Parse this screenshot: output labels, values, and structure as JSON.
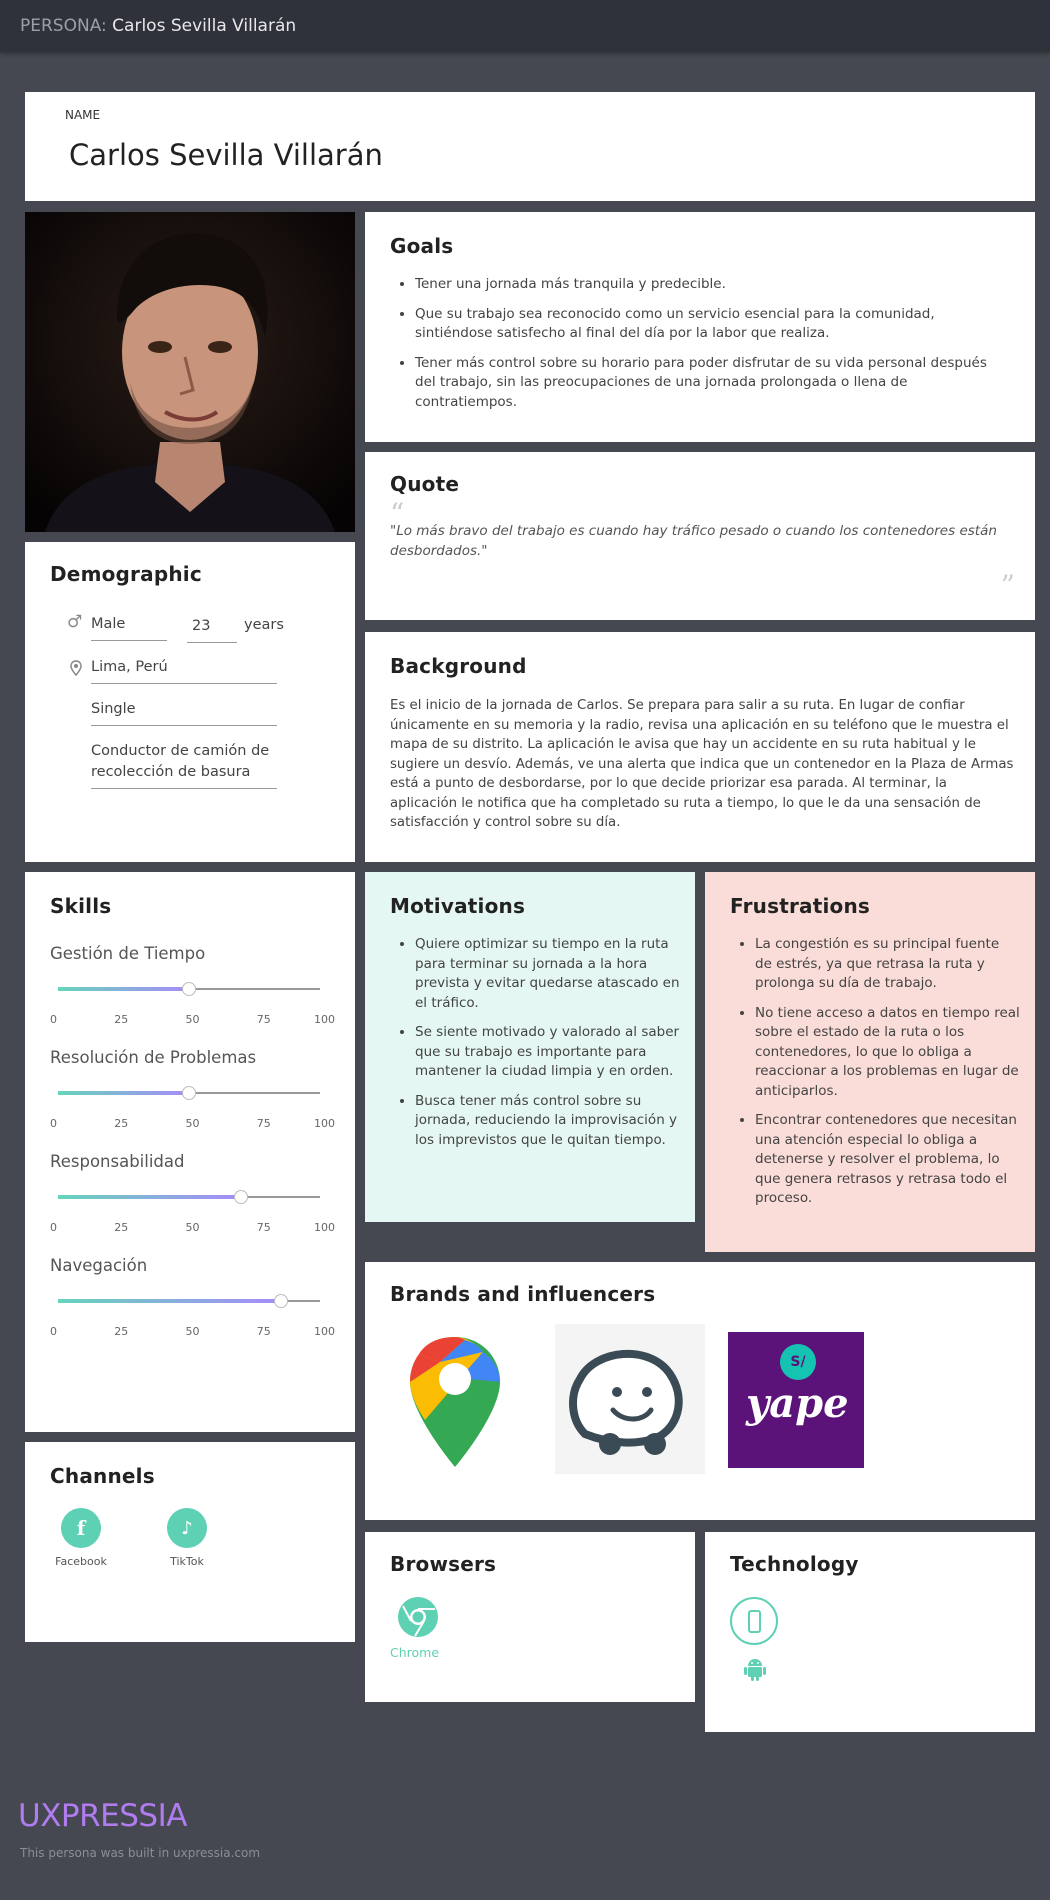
{
  "header": {
    "prefix": "PERSONA:",
    "name": "Carlos Sevilla Villarán"
  },
  "name_card": {
    "label": "NAME",
    "name": "Carlos Sevilla Villarán"
  },
  "goals": {
    "title": "Goals",
    "items": [
      "Tener una jornada más tranquila y predecible.",
      "Que su trabajo sea reconocido como un servicio esencial para la comunidad, sintiéndose satisfecho al final del día por la labor que realiza.",
      "Tener más control sobre su horario para poder disfrutar de su vida personal después del trabajo, sin las preocupaciones de una jornada prolongada o llena de contratiempos."
    ]
  },
  "quote": {
    "title": "Quote",
    "text": "\"Lo más bravo del trabajo es cuando hay tráfico pesado o cuando los contenedores están desbordados.\""
  },
  "demographic": {
    "title": "Demographic",
    "gender": "Male",
    "age": "23",
    "age_unit": "years",
    "location": "Lima, Perú",
    "status": "Single",
    "occupation": "Conductor de camión de recolección de basura"
  },
  "background": {
    "title": "Background",
    "text": "Es el inicio de la jornada de Carlos. Se prepara para salir a su ruta. En lugar de confiar únicamente en su memoria y la radio, revisa una aplicación en su teléfono que le muestra el mapa de su distrito. La aplicación le avisa que hay un accidente en su ruta habitual y le sugiere un desvío. Además, ve una alerta que indica que un contenedor en la Plaza de Armas está a punto de desbordarse, por lo que decide priorizar esa parada. Al terminar, la aplicación le notifica que ha completado su ruta a tiempo, lo que le da una sensación de satisfacción y control sobre su día."
  },
  "skills": {
    "title": "Skills",
    "ticks": [
      "0",
      "25",
      "50",
      "75",
      "100"
    ],
    "items": [
      {
        "name": "Gestión de Tiempo",
        "value": 50
      },
      {
        "name": "Resolución de Problemas",
        "value": 50
      },
      {
        "name": "Responsabilidad",
        "value": 70
      },
      {
        "name": "Navegación",
        "value": 85
      }
    ]
  },
  "motivations": {
    "title": "Motivations",
    "items": [
      "Quiere optimizar su tiempo en la ruta para terminar su jornada a la hora prevista y evitar quedarse atascado en el tráfico.",
      "Se siente motivado y valorado al saber que su trabajo es importante para mantener la ciudad limpia y en orden.",
      "Busca tener más control sobre su jornada, reduciendo la improvisación y los imprevistos que le quitan tiempo."
    ]
  },
  "frustrations": {
    "title": "Frustrations",
    "items": [
      "La congestión es su principal fuente de estrés, ya que retrasa la ruta y prolonga su día de trabajo.",
      "No tiene acceso a datos en tiempo real sobre el estado de la ruta o los contenedores, lo que lo obliga a reaccionar a los problemas en lugar de anticiparlos.",
      "Encontrar contenedores que necesitan una atención especial lo obliga a detenerse y resolver el problema, lo que genera retrasos y retrasa todo el proceso."
    ]
  },
  "brands": {
    "title": "Brands and influencers",
    "yape_label": "yape",
    "yape_badge": "S/"
  },
  "channels": {
    "title": "Channels",
    "items": [
      {
        "label": "Facebook",
        "icon": "facebook-icon"
      },
      {
        "label": "TikTok",
        "icon": "tiktok-icon"
      }
    ]
  },
  "browsers": {
    "title": "Browsers",
    "items": [
      {
        "label": "Chrome",
        "icon": "chrome-icon"
      }
    ]
  },
  "technology": {
    "title": "Technology",
    "items": [
      "smartphone-icon",
      "android-icon"
    ]
  },
  "footer": {
    "logo": "UXPRESSIA",
    "note": "This persona was built in uxpressia.com"
  },
  "colors": {
    "accent": "#5ed0b4",
    "motivations_bg": "#e4f7f2",
    "frustrations_bg": "#fadcd8",
    "logo": "#b07cf0"
  }
}
